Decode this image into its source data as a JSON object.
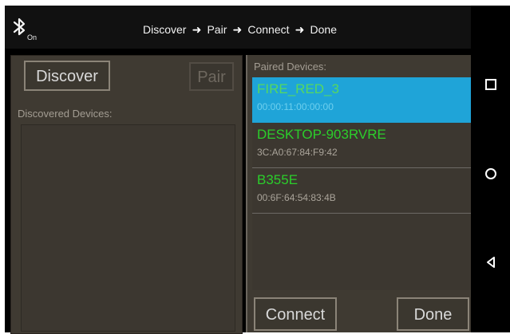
{
  "titlebar": {
    "bluetooth_state": "On",
    "workflow_steps": [
      "Discover",
      "Pair",
      "Connect",
      "Done"
    ]
  },
  "left_panel": {
    "discover_label": "Discover",
    "pair_label": "Pair",
    "discovered_label": "Discovered Devices:"
  },
  "right_panel": {
    "paired_label": "Paired Devices:",
    "connect_label": "Connect",
    "done_label": "Done",
    "devices": [
      {
        "name": "FIRE_RED_3",
        "mac": "00:00:11:00:00:00",
        "selected": true
      },
      {
        "name": "DESKTOP-903RVRE",
        "mac": "3C:A0:67:84:F9:42",
        "selected": false
      },
      {
        "name": "B355E",
        "mac": "00:6F:64:54:83:4B",
        "selected": false
      }
    ]
  },
  "colors": {
    "background": "#ffffff",
    "panel": "#3f3a32",
    "selected_row": "#1fa4d8",
    "device_name": "#2bce2b"
  },
  "icons": {
    "status": "bluetooth-icon",
    "navigation": [
      "recent-apps-icon",
      "home-icon",
      "back-icon"
    ]
  }
}
